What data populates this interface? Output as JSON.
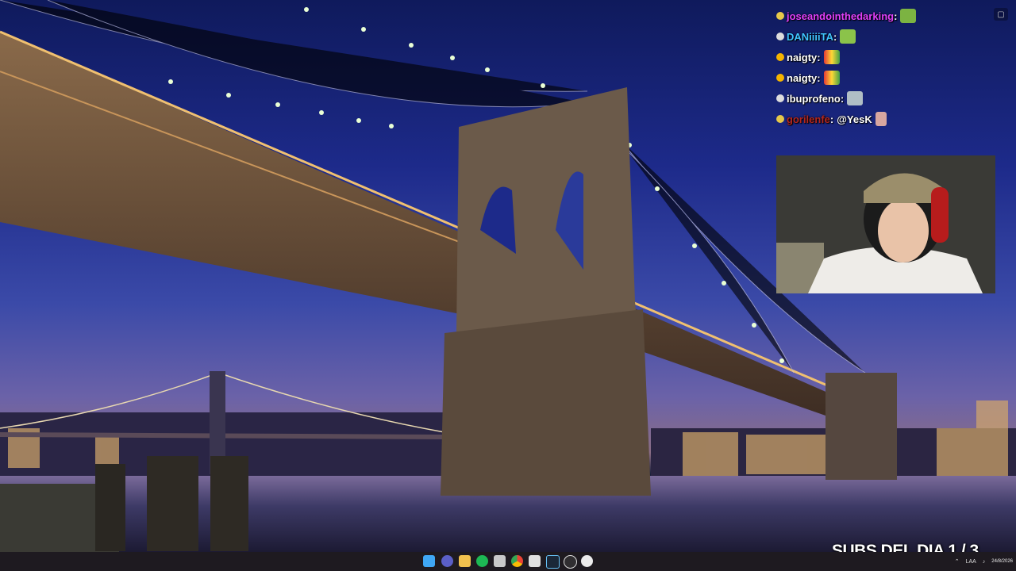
{
  "chat": {
    "messages": [
      {
        "user": "joseandointhedarking",
        "user_color": "#e040fb",
        "text": "",
        "badge_color": "#e6c84a"
      },
      {
        "user": "DANiiiiTA",
        "user_color": "#40c4ff",
        "text": "",
        "badge_color": "#dddddd"
      },
      {
        "user": "naigty",
        "user_color": "#ffffff",
        "text": "",
        "badge_color": "#f5b400"
      },
      {
        "user": "naigty",
        "user_color": "#ffffff",
        "text": "",
        "badge_color": "#f5b400"
      },
      {
        "user": "ibuprofeno",
        "user_color": "#ffffff",
        "text": "",
        "badge_color": "#dddddd"
      },
      {
        "user": "gorilenfe",
        "user_color": "#b3261e",
        "text": "@YesK",
        "badge_color": "#e6c84a"
      }
    ]
  },
  "webcam": {
    "label": "webcam-feed"
  },
  "subs_goal": {
    "text": "SUBS DEL DIA 1 / 3"
  },
  "taskbar": {
    "icons": [
      "windows-start-icon",
      "app-icon",
      "file-explorer-icon",
      "spotify-icon",
      "app-icon",
      "chrome-icon",
      "app-icon",
      "steam-icon",
      "obs-icon",
      "app-icon"
    ],
    "tray_lang": "LAA",
    "clock_date": "24/8/2026"
  },
  "colors": {
    "sky": "#1d2a8a",
    "taskbar": "#1e1a20",
    "bridge_stone": "#6b5a4a"
  }
}
